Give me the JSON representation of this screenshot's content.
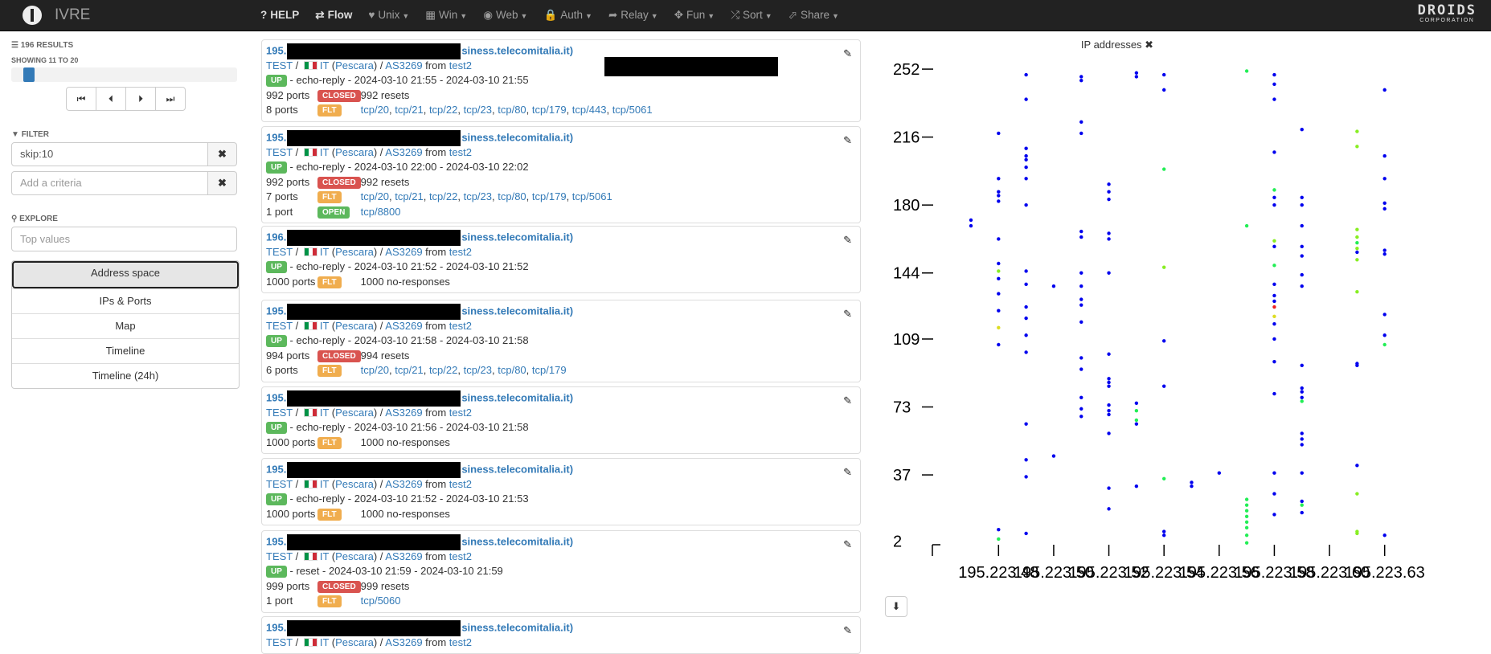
{
  "app": {
    "name": "IVRE",
    "corp_line1": "DROIDS",
    "corp_line2": "CORPORATION"
  },
  "nav": [
    {
      "label": "HELP",
      "icon": "?",
      "bold": true,
      "caret": false
    },
    {
      "label": "Flow",
      "icon": "⇄",
      "bold": true,
      "caret": false
    },
    {
      "label": "Unix",
      "icon": "♥",
      "bold": false,
      "caret": true
    },
    {
      "label": "Win",
      "icon": "▦",
      "bold": false,
      "caret": true
    },
    {
      "label": "Web",
      "icon": "◉",
      "bold": false,
      "caret": true
    },
    {
      "label": "Auth",
      "icon": "🔒",
      "bold": false,
      "caret": true
    },
    {
      "label": "Relay",
      "icon": "➦",
      "bold": false,
      "caret": true
    },
    {
      "label": "Fun",
      "icon": "✥",
      "bold": false,
      "caret": true
    },
    {
      "label": "Sort",
      "icon": "⤮",
      "bold": false,
      "caret": true
    },
    {
      "label": "Share",
      "icon": "⬀",
      "bold": false,
      "caret": true
    }
  ],
  "sidebar": {
    "results": "196 RESULTS",
    "showing": "SHOWING 11 TO 20",
    "slider_position": 0.05,
    "pager": [
      "⏮",
      "⏴",
      "⏵",
      "⏭"
    ],
    "filter_heading": "FILTER",
    "filter_value": "skip:10",
    "criteria_placeholder": "Add a criteria",
    "clear_icon": "✖",
    "explore_heading": "EXPLORE",
    "topvalues_placeholder": "Top values",
    "explore_items": [
      "Address space",
      "IPs & Ports",
      "Map",
      "Timeline",
      "Timeline (24h)"
    ]
  },
  "records": [
    {
      "ip_prefix": "195.",
      "host_suffix": "siness.telecomitalia.it)",
      "source": "TEST",
      "country": "IT",
      "city": "Pescara",
      "asn": "AS3269",
      "from_text": " from ",
      "probe": "test2",
      "status": "UP",
      "reason": "echo-reply",
      "times": "2024-03-10 21:55 - 2024-03-10 21:55",
      "rows": [
        {
          "count": "992 ports",
          "label": "CLOSED",
          "kind": "closed",
          "text": "992 resets",
          "links": []
        },
        {
          "count": "8 ports",
          "label": "FLT",
          "kind": "flt",
          "text": "",
          "links": [
            "tcp/20",
            "tcp/21",
            "tcp/22",
            "tcp/23",
            "tcp/80",
            "tcp/179",
            "tcp/443",
            "tcp/5061"
          ]
        }
      ]
    },
    {
      "ip_prefix": "195.",
      "host_suffix": "siness.telecomitalia.it)",
      "source": "TEST",
      "country": "IT",
      "city": "Pescara",
      "asn": "AS3269",
      "from_text": " from ",
      "probe": "test2",
      "status": "UP",
      "reason": "echo-reply",
      "times": "2024-03-10 22:00 - 2024-03-10 22:02",
      "rows": [
        {
          "count": "992 ports",
          "label": "CLOSED",
          "kind": "closed",
          "text": "992 resets",
          "links": []
        },
        {
          "count": "7 ports",
          "label": "FLT",
          "kind": "flt",
          "text": "",
          "links": [
            "tcp/20",
            "tcp/21",
            "tcp/22",
            "tcp/23",
            "tcp/80",
            "tcp/179",
            "tcp/5061"
          ]
        },
        {
          "count": "1 port",
          "label": "OPEN",
          "kind": "open",
          "text": "",
          "links": [
            "tcp/8800"
          ]
        }
      ]
    },
    {
      "ip_prefix": "196.",
      "host_suffix": "siness.telecomitalia.it)",
      "source": "TEST",
      "country": "IT",
      "city": "Pescara",
      "asn": "AS3269",
      "from_text": " from ",
      "probe": "test2",
      "status": "UP",
      "reason": "echo-reply",
      "times": "2024-03-10 21:52 - 2024-03-10 21:52",
      "rows": [
        {
          "count": "1000 ports",
          "label": "FLT",
          "kind": "flt",
          "text": "1000 no-responses",
          "links": []
        }
      ]
    },
    {
      "ip_prefix": "195.",
      "host_suffix": "siness.telecomitalia.it)",
      "source": "TEST",
      "country": "IT",
      "city": "Pescara",
      "asn": "AS3269",
      "from_text": " from ",
      "probe": "test2",
      "status": "UP",
      "reason": "echo-reply",
      "times": "2024-03-10 21:58 - 2024-03-10 21:58",
      "rows": [
        {
          "count": "994 ports",
          "label": "CLOSED",
          "kind": "closed",
          "text": "994 resets",
          "links": []
        },
        {
          "count": "6 ports",
          "label": "FLT",
          "kind": "flt",
          "text": "",
          "links": [
            "tcp/20",
            "tcp/21",
            "tcp/22",
            "tcp/23",
            "tcp/80",
            "tcp/179"
          ]
        }
      ]
    },
    {
      "ip_prefix": "195.",
      "host_suffix": "siness.telecomitalia.it)",
      "source": "TEST",
      "country": "IT",
      "city": "Pescara",
      "asn": "AS3269",
      "from_text": " from ",
      "probe": "test2",
      "status": "UP",
      "reason": "echo-reply",
      "times": "2024-03-10 21:56 - 2024-03-10 21:58",
      "rows": [
        {
          "count": "1000 ports",
          "label": "FLT",
          "kind": "flt",
          "text": "1000 no-responses",
          "links": []
        }
      ]
    },
    {
      "ip_prefix": "195.",
      "host_suffix": "siness.telecomitalia.it)",
      "source": "TEST",
      "country": "IT",
      "city": "Pescara",
      "asn": "AS3269",
      "from_text": " from ",
      "probe": "test2",
      "status": "UP",
      "reason": "echo-reply",
      "times": "2024-03-10 21:52 - 2024-03-10 21:53",
      "rows": [
        {
          "count": "1000 ports",
          "label": "FLT",
          "kind": "flt",
          "text": "1000 no-responses",
          "links": []
        }
      ]
    },
    {
      "ip_prefix": "195.",
      "host_suffix": "siness.telecomitalia.it)",
      "source": "TEST",
      "country": "IT",
      "city": "Pescara",
      "asn": "AS3269",
      "from_text": " from ",
      "probe": "test2",
      "status": "UP",
      "reason": "reset",
      "times": "2024-03-10 21:59 - 2024-03-10 21:59",
      "rows": [
        {
          "count": "999 ports",
          "label": "CLOSED",
          "kind": "closed",
          "text": "999 resets",
          "links": []
        },
        {
          "count": "1 port",
          "label": "FLT",
          "kind": "flt",
          "text": "",
          "links": [
            "tcp/5060"
          ]
        }
      ]
    },
    {
      "ip_prefix": "195.",
      "host_suffix": "siness.telecomitalia.it)",
      "source": "TEST",
      "country": "IT",
      "city": "Pescara",
      "asn": "AS3269",
      "from_text": " from ",
      "probe": "test2",
      "status": "UP",
      "reason": "",
      "times": "",
      "rows": []
    }
  ],
  "chart_data": {
    "type": "scatter",
    "title": "IP addresses",
    "close_icon": "✖",
    "download_icon": "⬇",
    "xticks": [
      "195.223.48",
      "195.223.50",
      "195.223.52",
      "195.223.54",
      "195.223.56",
      "195.223.58",
      "195.223.60",
      "195.223.63"
    ],
    "yticks": [
      "252",
      "216",
      "180",
      "144",
      "109",
      "73",
      "37",
      "2"
    ],
    "xlim": [
      47,
      63
    ],
    "ylim": [
      0,
      255
    ],
    "colors": {
      "blue": "#0000ee",
      "green": "#22ee55",
      "lime": "#88ee22",
      "yellow": "#dddd22",
      "red": "#ee2222"
    },
    "points": [
      [
        47,
        172,
        "blue"
      ],
      [
        47,
        169,
        "blue"
      ],
      [
        48,
        218,
        "blue"
      ],
      [
        48,
        194,
        "blue"
      ],
      [
        48,
        187,
        "blue"
      ],
      [
        48,
        185,
        "blue"
      ],
      [
        48,
        182,
        "blue"
      ],
      [
        48,
        162,
        "blue"
      ],
      [
        48,
        149,
        "blue"
      ],
      [
        48,
        145,
        "lime"
      ],
      [
        48,
        141,
        "blue"
      ],
      [
        48,
        133,
        "blue"
      ],
      [
        48,
        124,
        "blue"
      ],
      [
        48,
        115,
        "yellow"
      ],
      [
        48,
        106,
        "blue"
      ],
      [
        48,
        8,
        "blue"
      ],
      [
        48,
        3,
        "green"
      ],
      [
        49,
        249,
        "blue"
      ],
      [
        49,
        236,
        "blue"
      ],
      [
        49,
        210,
        "blue"
      ],
      [
        49,
        206,
        "blue"
      ],
      [
        49,
        204,
        "blue"
      ],
      [
        49,
        200,
        "blue"
      ],
      [
        49,
        194,
        "blue"
      ],
      [
        49,
        180,
        "blue"
      ],
      [
        49,
        145,
        "blue"
      ],
      [
        49,
        138,
        "blue"
      ],
      [
        49,
        126,
        "blue"
      ],
      [
        49,
        120,
        "blue"
      ],
      [
        49,
        111,
        "blue"
      ],
      [
        49,
        102,
        "blue"
      ],
      [
        49,
        64,
        "blue"
      ],
      [
        49,
        45,
        "blue"
      ],
      [
        49,
        36,
        "blue"
      ],
      [
        49,
        6,
        "blue"
      ],
      [
        50,
        137,
        "blue"
      ],
      [
        50,
        47,
        "blue"
      ],
      [
        51,
        248,
        "blue"
      ],
      [
        51,
        246,
        "blue"
      ],
      [
        51,
        224,
        "blue"
      ],
      [
        51,
        218,
        "blue"
      ],
      [
        51,
        166,
        "blue"
      ],
      [
        51,
        163,
        "blue"
      ],
      [
        51,
        144,
        "blue"
      ],
      [
        51,
        137,
        "blue"
      ],
      [
        51,
        130,
        "blue"
      ],
      [
        51,
        127,
        "blue"
      ],
      [
        51,
        118,
        "blue"
      ],
      [
        51,
        99,
        "blue"
      ],
      [
        51,
        93,
        "blue"
      ],
      [
        51,
        78,
        "blue"
      ],
      [
        51,
        72,
        "blue"
      ],
      [
        51,
        68,
        "blue"
      ],
      [
        52,
        191,
        "blue"
      ],
      [
        52,
        187,
        "blue"
      ],
      [
        52,
        183,
        "blue"
      ],
      [
        52,
        165,
        "blue"
      ],
      [
        52,
        162,
        "blue"
      ],
      [
        52,
        144,
        "blue"
      ],
      [
        52,
        101,
        "blue"
      ],
      [
        52,
        88,
        "blue"
      ],
      [
        52,
        86,
        "blue"
      ],
      [
        52,
        84,
        "blue"
      ],
      [
        52,
        74,
        "blue"
      ],
      [
        52,
        71,
        "blue"
      ],
      [
        52,
        69,
        "blue"
      ],
      [
        52,
        59,
        "blue"
      ],
      [
        52,
        30,
        "blue"
      ],
      [
        52,
        19,
        "blue"
      ],
      [
        53,
        250,
        "blue"
      ],
      [
        53,
        248,
        "blue"
      ],
      [
        53,
        75,
        "blue"
      ],
      [
        53,
        71,
        "green"
      ],
      [
        53,
        66,
        "green"
      ],
      [
        53,
        64,
        "blue"
      ],
      [
        53,
        31,
        "blue"
      ],
      [
        54,
        249,
        "blue"
      ],
      [
        54,
        241,
        "blue"
      ],
      [
        54,
        199,
        "green"
      ],
      [
        54,
        147,
        "lime"
      ],
      [
        54,
        108,
        "blue"
      ],
      [
        54,
        84,
        "blue"
      ],
      [
        54,
        35,
        "green"
      ],
      [
        54,
        7,
        "blue"
      ],
      [
        54,
        5,
        "blue"
      ],
      [
        55,
        33,
        "blue"
      ],
      [
        55,
        31,
        "blue"
      ],
      [
        56,
        38,
        "blue"
      ],
      [
        57,
        251,
        "green"
      ],
      [
        57,
        169,
        "green"
      ],
      [
        57,
        24,
        "green"
      ],
      [
        57,
        21,
        "green"
      ],
      [
        57,
        18,
        "green"
      ],
      [
        57,
        15,
        "green"
      ],
      [
        57,
        12,
        "green"
      ],
      [
        57,
        9,
        "green"
      ],
      [
        57,
        5,
        "green"
      ],
      [
        57,
        1,
        "green"
      ],
      [
        58,
        249,
        "blue"
      ],
      [
        58,
        244,
        "blue"
      ],
      [
        58,
        236,
        "blue"
      ],
      [
        58,
        208,
        "blue"
      ],
      [
        58,
        188,
        "green"
      ],
      [
        58,
        184,
        "blue"
      ],
      [
        58,
        180,
        "blue"
      ],
      [
        58,
        161,
        "lime"
      ],
      [
        58,
        158,
        "blue"
      ],
      [
        58,
        148,
        "green"
      ],
      [
        58,
        138,
        "blue"
      ],
      [
        58,
        132,
        "blue"
      ],
      [
        58,
        129,
        "blue"
      ],
      [
        58,
        126,
        "red"
      ],
      [
        58,
        121,
        "yellow"
      ],
      [
        58,
        117,
        "blue"
      ],
      [
        58,
        109,
        "blue"
      ],
      [
        58,
        97,
        "blue"
      ],
      [
        58,
        80,
        "blue"
      ],
      [
        58,
        38,
        "blue"
      ],
      [
        58,
        27,
        "blue"
      ],
      [
        58,
        16,
        "blue"
      ],
      [
        59,
        220,
        "blue"
      ],
      [
        59,
        184,
        "blue"
      ],
      [
        59,
        180,
        "blue"
      ],
      [
        59,
        169,
        "blue"
      ],
      [
        59,
        158,
        "blue"
      ],
      [
        59,
        153,
        "blue"
      ],
      [
        59,
        143,
        "blue"
      ],
      [
        59,
        137,
        "blue"
      ],
      [
        59,
        95,
        "blue"
      ],
      [
        59,
        83,
        "blue"
      ],
      [
        59,
        81,
        "blue"
      ],
      [
        59,
        78,
        "blue"
      ],
      [
        59,
        76,
        "green"
      ],
      [
        59,
        59,
        "blue"
      ],
      [
        59,
        56,
        "blue"
      ],
      [
        59,
        53,
        "blue"
      ],
      [
        59,
        38,
        "blue"
      ],
      [
        59,
        23,
        "blue"
      ],
      [
        59,
        21,
        "green"
      ],
      [
        59,
        17,
        "blue"
      ],
      [
        61,
        219,
        "lime"
      ],
      [
        61,
        211,
        "lime"
      ],
      [
        61,
        167,
        "lime"
      ],
      [
        61,
        163,
        "lime"
      ],
      [
        61,
        160,
        "green"
      ],
      [
        61,
        157,
        "lime"
      ],
      [
        61,
        155,
        "blue"
      ],
      [
        61,
        151,
        "lime"
      ],
      [
        61,
        134,
        "lime"
      ],
      [
        61,
        96,
        "blue"
      ],
      [
        61,
        95,
        "blue"
      ],
      [
        61,
        42,
        "blue"
      ],
      [
        61,
        27,
        "lime"
      ],
      [
        61,
        7,
        "lime"
      ],
      [
        61,
        6,
        "lime"
      ],
      [
        62,
        241,
        "blue"
      ],
      [
        62,
        206,
        "blue"
      ],
      [
        62,
        194,
        "blue"
      ],
      [
        62,
        181,
        "blue"
      ],
      [
        62,
        178,
        "blue"
      ],
      [
        62,
        156,
        "blue"
      ],
      [
        62,
        154,
        "blue"
      ],
      [
        62,
        122,
        "blue"
      ],
      [
        62,
        111,
        "blue"
      ],
      [
        62,
        106,
        "green"
      ],
      [
        62,
        5,
        "blue"
      ]
    ]
  }
}
